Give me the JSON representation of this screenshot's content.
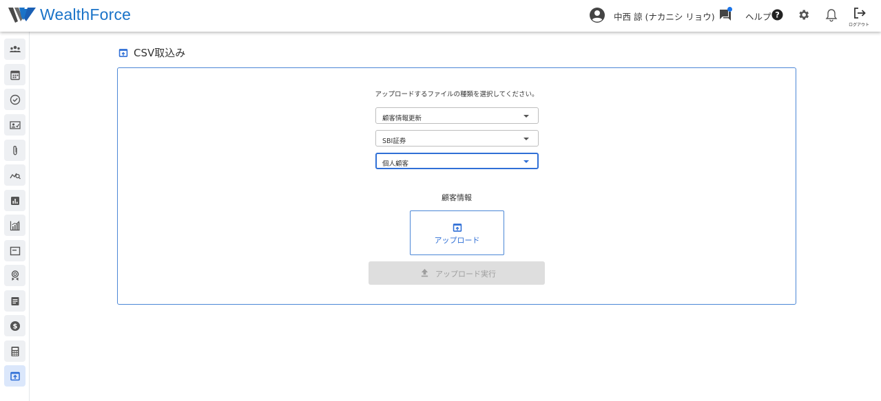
{
  "header": {
    "logo_text": "WealthForce",
    "user_name": "中西 諒 (ナカニシ リョウ)",
    "help_label": "ヘルプ",
    "logout_label": "ログアウト"
  },
  "sidebar": {
    "items": [
      {
        "name": "customers",
        "icon": "people-icon"
      },
      {
        "name": "calendar",
        "icon": "calendar-icon"
      },
      {
        "name": "tasks",
        "icon": "check-circle-icon"
      },
      {
        "name": "contacts",
        "icon": "contact-card-icon"
      },
      {
        "name": "attachments",
        "icon": "paperclip-icon"
      },
      {
        "name": "analysis",
        "icon": "chart-search-icon"
      },
      {
        "name": "reports",
        "icon": "bar-chart-icon"
      },
      {
        "name": "statistics",
        "icon": "analytics-icon"
      },
      {
        "name": "messages",
        "icon": "message-box-icon"
      },
      {
        "name": "rewards",
        "icon": "award-icon"
      },
      {
        "name": "documents",
        "icon": "document-icon"
      },
      {
        "name": "fees",
        "icon": "dollar-icon"
      },
      {
        "name": "calculator",
        "icon": "calculator-icon"
      },
      {
        "name": "csv-import",
        "icon": "upload-box-icon",
        "active": true
      }
    ]
  },
  "main": {
    "title": "CSV取込み",
    "instruction": "アップロードするファイルの種類を選択してください。",
    "selects": [
      {
        "value": "顧客情報更新"
      },
      {
        "value": "SBI証券"
      },
      {
        "value": "個人顧客"
      }
    ],
    "section_label": "顧客情報",
    "upload_label": "アップロード",
    "execute_label": "アップロード実行"
  },
  "colors": {
    "accent": "#2f6fd6",
    "brand": "#1a73c8",
    "disabled_bg": "#dedede"
  }
}
